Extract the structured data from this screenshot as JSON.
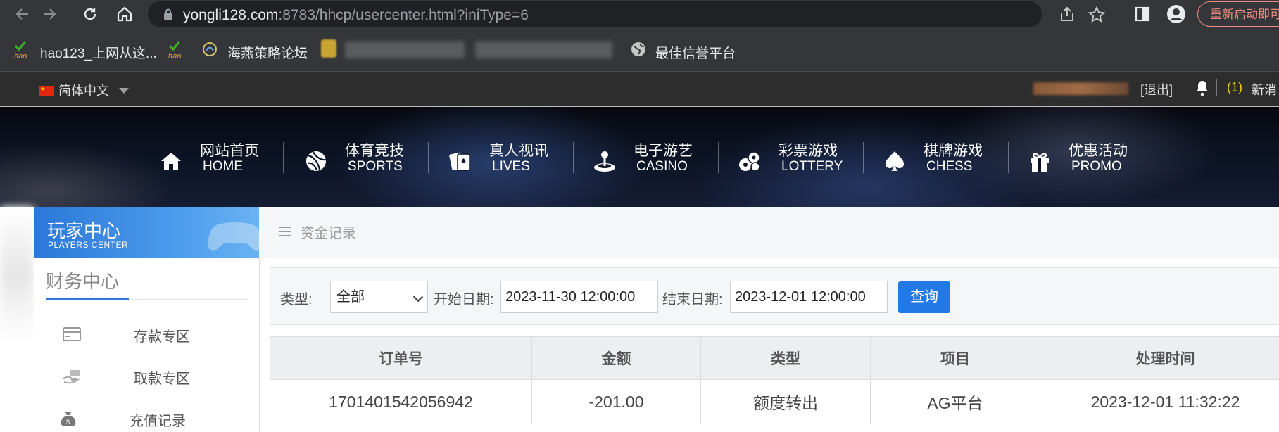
{
  "browser": {
    "url_host": "yongli128.com",
    "url_rest": ":8783/hhcp/usercenter.html?iniType=6",
    "restart_label": "重新启动即可"
  },
  "bookmarks": [
    {
      "label": "hao123_上网从这..."
    },
    {
      "label": ""
    },
    {
      "label": "海燕策略论坛"
    },
    {
      "label": "最佳信誉平台"
    }
  ],
  "topbar": {
    "language": "简体中文",
    "logout": "[退出]",
    "message_count": "(1)",
    "message_label": "新消"
  },
  "nav": [
    {
      "cn": "网站首页",
      "en": "HOME",
      "icon": "home-icon"
    },
    {
      "cn": "体育竞技",
      "en": "SPORTS",
      "icon": "sports-ball-icon"
    },
    {
      "cn": "真人视讯",
      "en": "LIVES",
      "icon": "playing-cards-icon"
    },
    {
      "cn": "电子游艺",
      "en": "CASINO",
      "icon": "joystick-icon"
    },
    {
      "cn": "彩票游戏",
      "en": "LOTTERY",
      "icon": "lottery-balls-icon"
    },
    {
      "cn": "棋牌游戏",
      "en": "CHESS",
      "icon": "spade-icon"
    },
    {
      "cn": "优惠活动",
      "en": "PROMO",
      "icon": "gift-icon"
    }
  ],
  "sidebar": {
    "header_cn": "玩家中心",
    "header_en": "PLAYERS CENTER",
    "section_title": "财务中心",
    "items": [
      {
        "label": "存款专区",
        "icon": "card-icon"
      },
      {
        "label": "取款专区",
        "icon": "hand-money-icon"
      },
      {
        "label": "充值记录",
        "icon": "money-bag-icon"
      }
    ]
  },
  "main": {
    "section_title": "资金记录",
    "filter": {
      "type_label": "类型:",
      "type_value": "全部",
      "start_label": "开始日期:",
      "start_value": "2023-11-30 12:00:00",
      "end_label": "结束日期:",
      "end_value": "2023-12-01 12:00:00",
      "query_label": "查询"
    },
    "table": {
      "headers": [
        "订单号",
        "金额",
        "类型",
        "项目",
        "处理时间"
      ],
      "rows": [
        [
          "1701401542056942",
          "-201.00",
          "额度转出",
          "AG平台",
          "2023-12-01 11:32:22"
        ]
      ]
    }
  }
}
